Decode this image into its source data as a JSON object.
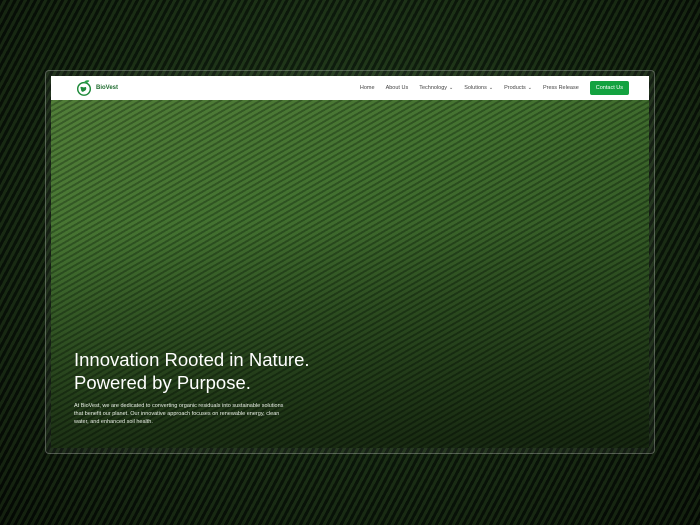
{
  "brand": {
    "name": "BioVest"
  },
  "nav": {
    "items": [
      {
        "label": "Home"
      },
      {
        "label": "About Us"
      },
      {
        "label": "Technology",
        "dropdown": true
      },
      {
        "label": "Solutions",
        "dropdown": true
      },
      {
        "label": "Products",
        "dropdown": true
      },
      {
        "label": "Press Release"
      }
    ],
    "cta": "Contact Us",
    "chevron": "⌄"
  },
  "hero": {
    "title_line1": "Innovation Rooted in Nature.",
    "title_line2": "Powered by Purpose.",
    "description": "At BioVest, we are dedicated to converting organic residuals into sustainable solutions that benefit our planet. Our innovative approach focuses on renewable energy, clean water, and enhanced soil health."
  },
  "colors": {
    "accent": "#13a23f",
    "brand": "#1e6b2e"
  }
}
